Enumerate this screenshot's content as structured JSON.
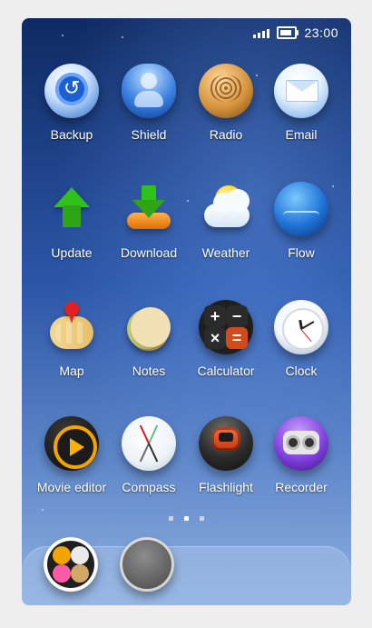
{
  "status_bar": {
    "time": "23:00",
    "signal_icon": "signal-bars-icon",
    "battery_icon": "battery-icon"
  },
  "apps": [
    {
      "id": "backup",
      "label": "Backup",
      "icon": "backup-icon"
    },
    {
      "id": "shield",
      "label": "Shield",
      "icon": "shield-icon"
    },
    {
      "id": "radio",
      "label": "Radio",
      "icon": "radio-icon"
    },
    {
      "id": "email",
      "label": "Email",
      "icon": "email-icon"
    },
    {
      "id": "update",
      "label": "Update",
      "icon": "update-arrow-icon"
    },
    {
      "id": "download",
      "label": "Download",
      "icon": "download-icon"
    },
    {
      "id": "weather",
      "label": "Weather",
      "icon": "weather-icon"
    },
    {
      "id": "flow",
      "label": "Flow",
      "icon": "flow-icon"
    },
    {
      "id": "map",
      "label": "Map",
      "icon": "map-icon"
    },
    {
      "id": "notes",
      "label": "Notes",
      "icon": "notes-icon"
    },
    {
      "id": "calculator",
      "label": "Calculator",
      "icon": "calculator-icon"
    },
    {
      "id": "clock",
      "label": "Clock",
      "icon": "clock-icon"
    },
    {
      "id": "movie_editor",
      "label": "Movie editor",
      "icon": "movie-editor-icon"
    },
    {
      "id": "compass",
      "label": "Compass",
      "icon": "compass-icon"
    },
    {
      "id": "flashlight",
      "label": "Flashlight",
      "icon": "flashlight-icon"
    },
    {
      "id": "recorder",
      "label": "Recorder",
      "icon": "recorder-icon"
    }
  ],
  "page_indicator": {
    "pages": 3,
    "active_index": 1
  },
  "dock": {
    "items": [
      {
        "id": "folder",
        "icon": "folder-icon"
      },
      {
        "id": "empty_slot",
        "icon": "empty-slot-icon"
      }
    ]
  },
  "colors": {
    "wallpaper_top": "#0f2a63",
    "wallpaper_mid": "#2b56a8",
    "wallpaper_bottom": "#8fb1e2",
    "label_text": "#ffffff",
    "accent_orange": "#f5a300",
    "accent_red": "#e32020"
  }
}
